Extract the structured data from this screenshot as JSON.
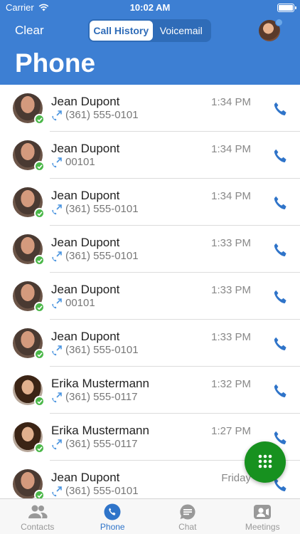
{
  "status_bar": {
    "carrier": "Carrier",
    "time": "10:02 AM"
  },
  "header": {
    "clear_label": "Clear",
    "segments": [
      {
        "label": "Call History",
        "active": true
      },
      {
        "label": "Voicemail",
        "active": false
      }
    ],
    "title": "Phone"
  },
  "calls": [
    {
      "name": "Jean Dupont",
      "number": "(361) 555-0101",
      "time": "1:34 PM",
      "avatar": "male"
    },
    {
      "name": "Jean Dupont",
      "number": "00101",
      "time": "1:34 PM",
      "avatar": "male"
    },
    {
      "name": "Jean Dupont",
      "number": "(361) 555-0101",
      "time": "1:34 PM",
      "avatar": "male"
    },
    {
      "name": "Jean Dupont",
      "number": "(361) 555-0101",
      "time": "1:33 PM",
      "avatar": "male"
    },
    {
      "name": "Jean Dupont",
      "number": "00101",
      "time": "1:33 PM",
      "avatar": "male"
    },
    {
      "name": "Jean Dupont",
      "number": "(361) 555-0101",
      "time": "1:33 PM",
      "avatar": "male"
    },
    {
      "name": "Erika Mustermann",
      "number": "(361) 555-0117",
      "time": "1:32 PM",
      "avatar": "female"
    },
    {
      "name": "Erika Mustermann",
      "number": "(361) 555-0117",
      "time": "1:27 PM",
      "avatar": "female"
    },
    {
      "name": "Jean Dupont",
      "number": "(361) 555-0101",
      "time": "Friday",
      "avatar": "male"
    }
  ],
  "tabs": [
    {
      "label": "Contacts",
      "icon": "contacts-icon",
      "active": false
    },
    {
      "label": "Phone",
      "icon": "phone-icon",
      "active": true
    },
    {
      "label": "Chat",
      "icon": "chat-icon",
      "active": false
    },
    {
      "label": "Meetings",
      "icon": "meetings-icon",
      "active": false
    }
  ],
  "colors": {
    "header": "#3d7fd3",
    "accent": "#2f74c9",
    "fab": "#17911f",
    "presence": "#4cb84a"
  }
}
